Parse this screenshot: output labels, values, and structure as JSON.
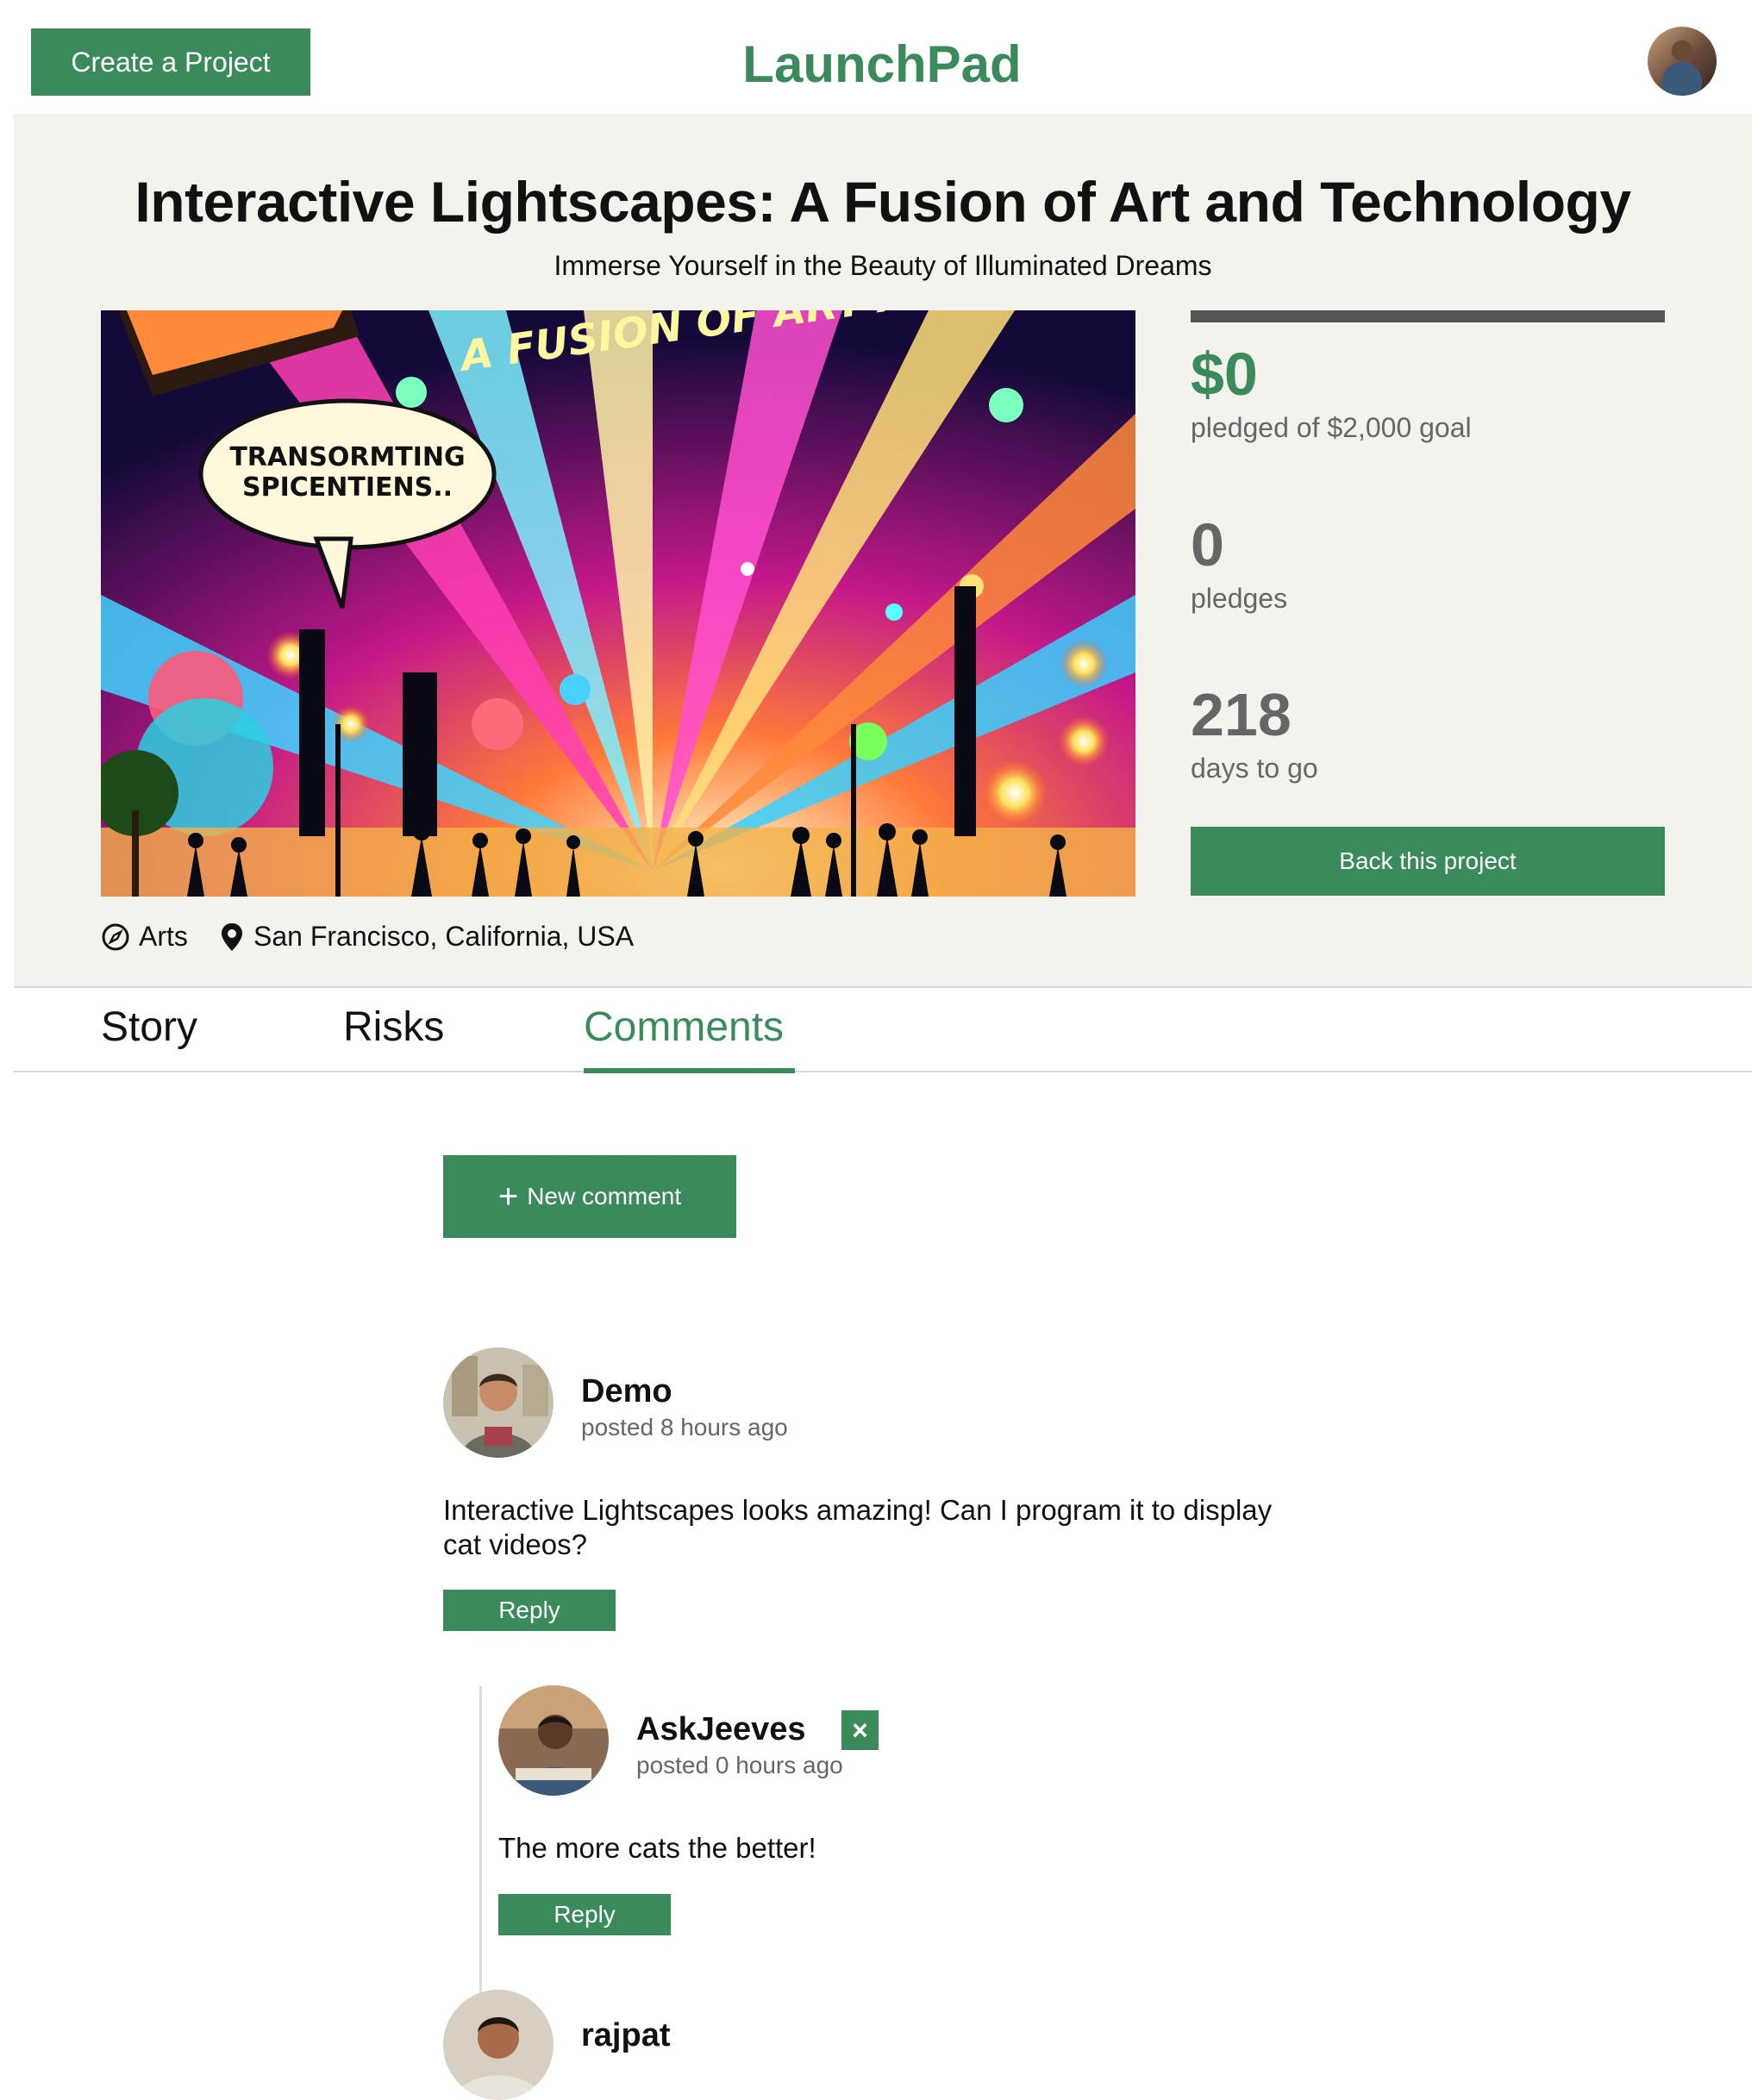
{
  "header": {
    "create_label": "Create a Project",
    "brand": "LaunchPad",
    "user_avatar_icon": "user-avatar"
  },
  "project": {
    "title": "Interactive Lightscapes: A Fusion of Art and Technology",
    "subtitle": "Immerse Yourself in the Beauty of Illuminated Dreams",
    "image_banner_text": "A FUSION OF ART AN",
    "image_bubble_line1": "TRANSORMTING",
    "image_bubble_line2": "SPICENTIENS..",
    "funded_fraction": 0,
    "pledged": "$0",
    "pledged_label": "pledged of $2,000 goal",
    "backers": "0",
    "backers_label": "pledges",
    "days": "218",
    "days_label": "days to go",
    "back_label": "Back this project",
    "category": "Arts",
    "category_icon": "compass-icon",
    "location": "San Francisco, California, USA",
    "location_icon": "map-pin-icon"
  },
  "tabs": [
    {
      "label": "Story"
    },
    {
      "label": "Risks"
    },
    {
      "label": "Comments",
      "active": true
    }
  ],
  "comments_section": {
    "new_comment_label": "New comment",
    "new_comment_icon": "plus-icon"
  },
  "comments": [
    {
      "author": "Demo",
      "time": "posted 8 hours ago",
      "line1": "Interactive Lightscapes looks amazing! Can I program it to display",
      "line2": "cat videos?",
      "reply_label": "Reply"
    },
    {
      "author": "AskJeeves",
      "time": "posted 0 hours ago",
      "body": "The more cats the better!",
      "reply_label": "Reply",
      "delete_label": "×"
    },
    {
      "author": "rajpat"
    }
  ],
  "colors": {
    "accent": "#3a8a5c",
    "hero_bg": "#f4f2ec",
    "muted_text": "#666666"
  }
}
